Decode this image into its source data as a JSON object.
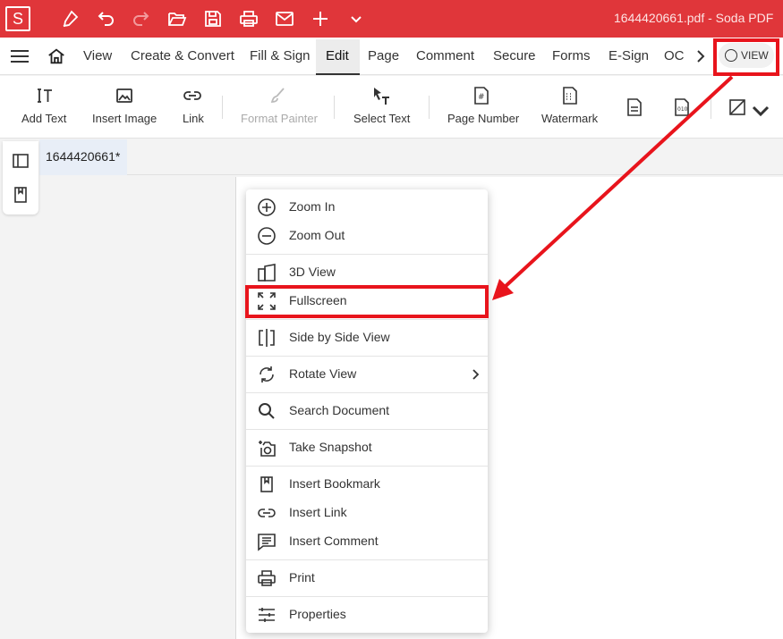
{
  "app": {
    "logo_letter": "S",
    "document_title": "1644420661.pdf  -  Soda PDF"
  },
  "menubar": {
    "items": [
      "View",
      "Create & Convert",
      "Fill & Sign",
      "Edit",
      "Page",
      "Comment",
      "Secure",
      "Forms",
      "E-Sign",
      "OC"
    ],
    "active": "Edit",
    "view_button": "VIEW"
  },
  "ribbon": {
    "tools": [
      {
        "label": "Add Text",
        "icon": "add-text-icon"
      },
      {
        "label": "Insert Image",
        "icon": "image-icon"
      },
      {
        "label": "Link",
        "icon": "link-icon"
      },
      {
        "label": "Format Painter",
        "icon": "brush-icon",
        "disabled": true
      },
      {
        "label": "Select Text",
        "icon": "select-text-icon"
      },
      {
        "label": "Page Number",
        "icon": "page-number-icon"
      },
      {
        "label": "Watermark",
        "icon": "watermark-icon"
      }
    ]
  },
  "tabs": {
    "document_tab": "1644420661*"
  },
  "view_menu": {
    "items": [
      {
        "label": "Zoom In",
        "icon": "zoom-in-icon"
      },
      {
        "label": "Zoom Out",
        "icon": "zoom-out-icon"
      },
      {
        "label": "3D View",
        "icon": "3d-view-icon"
      },
      {
        "label": "Fullscreen",
        "icon": "fullscreen-icon",
        "highlighted": true
      },
      {
        "label": "Side by Side View",
        "icon": "side-by-side-icon"
      },
      {
        "label": "Rotate View",
        "icon": "rotate-icon",
        "has_submenu": true
      },
      {
        "label": "Search Document",
        "icon": "search-icon"
      },
      {
        "label": "Take Snapshot",
        "icon": "snapshot-icon"
      },
      {
        "label": "Insert Bookmark",
        "icon": "bookmark-icon"
      },
      {
        "label": "Insert Link",
        "icon": "link-icon"
      },
      {
        "label": "Insert Comment",
        "icon": "comment-icon"
      },
      {
        "label": "Print",
        "icon": "print-icon"
      },
      {
        "label": "Properties",
        "icon": "properties-icon"
      }
    ]
  },
  "colors": {
    "brand_red": "#e0363a",
    "annotation_red": "#e8141c"
  }
}
